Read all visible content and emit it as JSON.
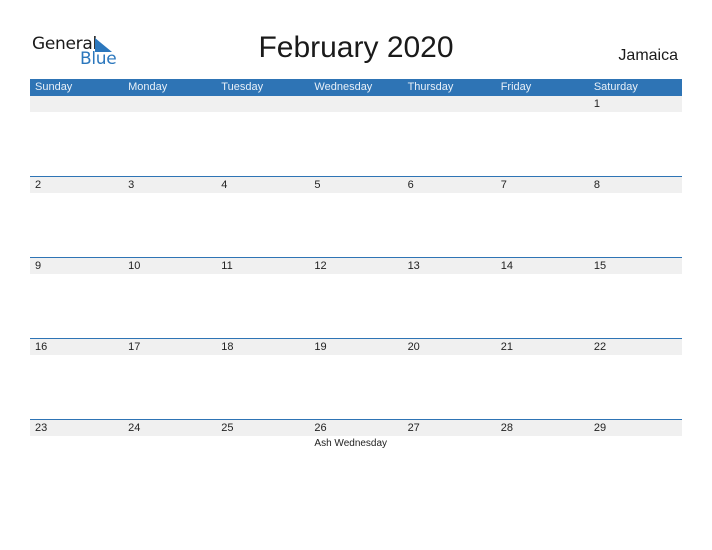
{
  "logo": {
    "line1": "General",
    "line2": "Blue",
    "icon": "triangle-flag-icon"
  },
  "title": "February 2020",
  "country": "Jamaica",
  "colors": {
    "accent": "#2e74b5",
    "strip": "#f0f0f0",
    "logo_blue": "#2b77bd"
  },
  "days": [
    "Sunday",
    "Monday",
    "Tuesday",
    "Wednesday",
    "Thursday",
    "Friday",
    "Saturday"
  ],
  "weeks": [
    {
      "cells": [
        {
          "day": ""
        },
        {
          "day": ""
        },
        {
          "day": ""
        },
        {
          "day": ""
        },
        {
          "day": ""
        },
        {
          "day": ""
        },
        {
          "day": "1"
        }
      ]
    },
    {
      "cells": [
        {
          "day": "2"
        },
        {
          "day": "3"
        },
        {
          "day": "4"
        },
        {
          "day": "5"
        },
        {
          "day": "6"
        },
        {
          "day": "7"
        },
        {
          "day": "8"
        }
      ]
    },
    {
      "cells": [
        {
          "day": "9"
        },
        {
          "day": "10"
        },
        {
          "day": "11"
        },
        {
          "day": "12"
        },
        {
          "day": "13"
        },
        {
          "day": "14"
        },
        {
          "day": "15"
        }
      ]
    },
    {
      "cells": [
        {
          "day": "16"
        },
        {
          "day": "17"
        },
        {
          "day": "18"
        },
        {
          "day": "19"
        },
        {
          "day": "20"
        },
        {
          "day": "21"
        },
        {
          "day": "22"
        }
      ]
    },
    {
      "cells": [
        {
          "day": "23"
        },
        {
          "day": "24"
        },
        {
          "day": "25"
        },
        {
          "day": "26",
          "event": "Ash Wednesday"
        },
        {
          "day": "27"
        },
        {
          "day": "28"
        },
        {
          "day": "29"
        }
      ]
    }
  ]
}
